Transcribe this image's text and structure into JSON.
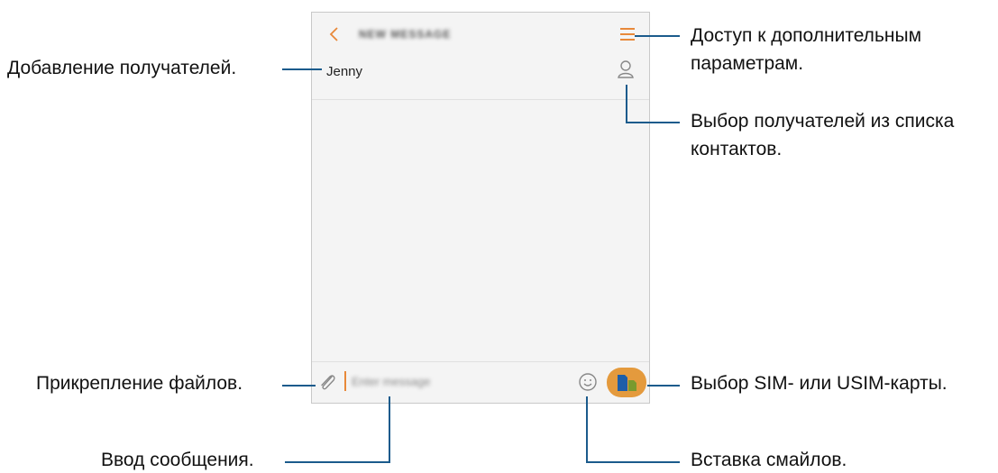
{
  "screen": {
    "title": "NEW MESSAGE",
    "recipient": "Jenny",
    "input_placeholder": "Enter message",
    "accent_color": "#e8893a",
    "icons": [
      "back-icon",
      "menu-icon",
      "person-icon",
      "paperclip-icon",
      "smiley-icon",
      "sim-icon"
    ]
  },
  "annotations": {
    "menu_line1": "Доступ к дополнительным",
    "menu_line2": "параметрам.",
    "contacts_line1": "Выбор получателей из списка",
    "contacts_line2": "контактов.",
    "add_recipients": "Добавление получателей.",
    "attach": "Прикрепление файлов.",
    "sim": "Выбор SIM- или USIM-карты.",
    "input": "Ввод сообщения.",
    "emoji": "Вставка смайлов."
  }
}
